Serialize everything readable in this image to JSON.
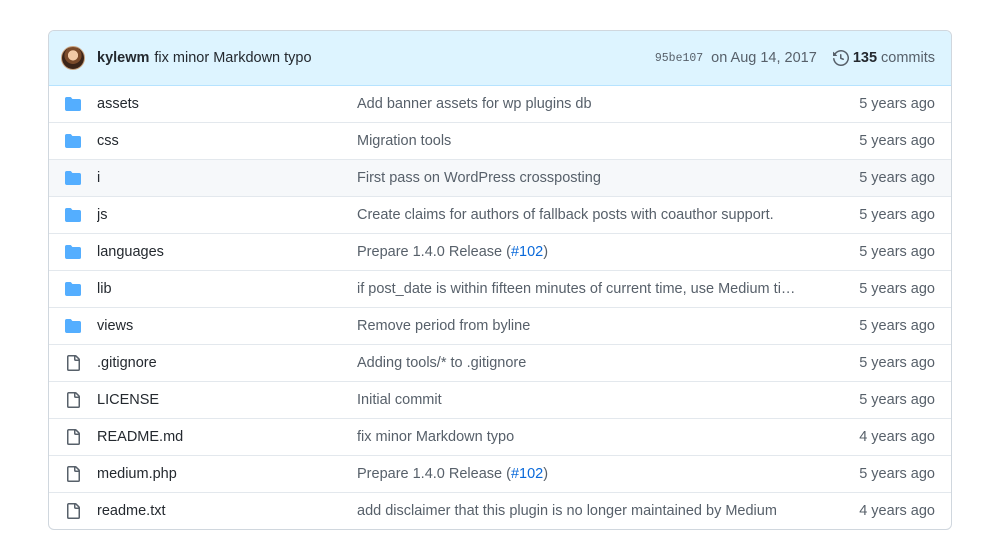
{
  "commit": {
    "author": "kylewm",
    "message": "fix minor Markdown typo",
    "sha": "95be107",
    "date": "on Aug 14, 2017",
    "commit_count": "135",
    "commit_word": "commits"
  },
  "files": [
    {
      "type": "folder",
      "name": "assets",
      "message": "Add banner assets for wp plugins db",
      "age": "5 years ago"
    },
    {
      "type": "folder",
      "name": "css",
      "message": "Migration tools",
      "age": "5 years ago"
    },
    {
      "type": "folder",
      "name": "i",
      "message": "First pass on WordPress crossposting",
      "age": "5 years ago"
    },
    {
      "type": "folder",
      "name": "js",
      "message": "Create claims for authors of fallback posts with coauthor support.",
      "age": "5 years ago"
    },
    {
      "type": "folder",
      "name": "languages",
      "message": "Prepare 1.4.0 Release (",
      "link": "#102",
      "message_end": ")",
      "age": "5 years ago"
    },
    {
      "type": "folder",
      "name": "lib",
      "message": "if post_date is within fifteen minutes of current time, use Medium ti…",
      "age": "5 years ago"
    },
    {
      "type": "folder",
      "name": "views",
      "message": "Remove period from byline",
      "age": "5 years ago"
    },
    {
      "type": "file",
      "name": ".gitignore",
      "message": "Adding tools/* to .gitignore",
      "age": "5 years ago"
    },
    {
      "type": "file",
      "name": "LICENSE",
      "message": "Initial commit",
      "age": "5 years ago"
    },
    {
      "type": "file",
      "name": "README.md",
      "message": "fix minor Markdown typo",
      "age": "4 years ago"
    },
    {
      "type": "file",
      "name": "medium.php",
      "message": "Prepare 1.4.0 Release (",
      "link": "#102",
      "message_end": ")",
      "age": "5 years ago"
    },
    {
      "type": "file",
      "name": "readme.txt",
      "message": "add disclaimer that this plugin is no longer maintained by Medium",
      "age": "4 years ago"
    }
  ],
  "icons": {
    "folder": "folder-icon",
    "file": "file-icon",
    "history": "history-icon"
  },
  "colors": {
    "folder": "#54aeff",
    "file": "#57606a",
    "link": "#0969da",
    "commit_bar_bg": "#ddf4ff"
  }
}
